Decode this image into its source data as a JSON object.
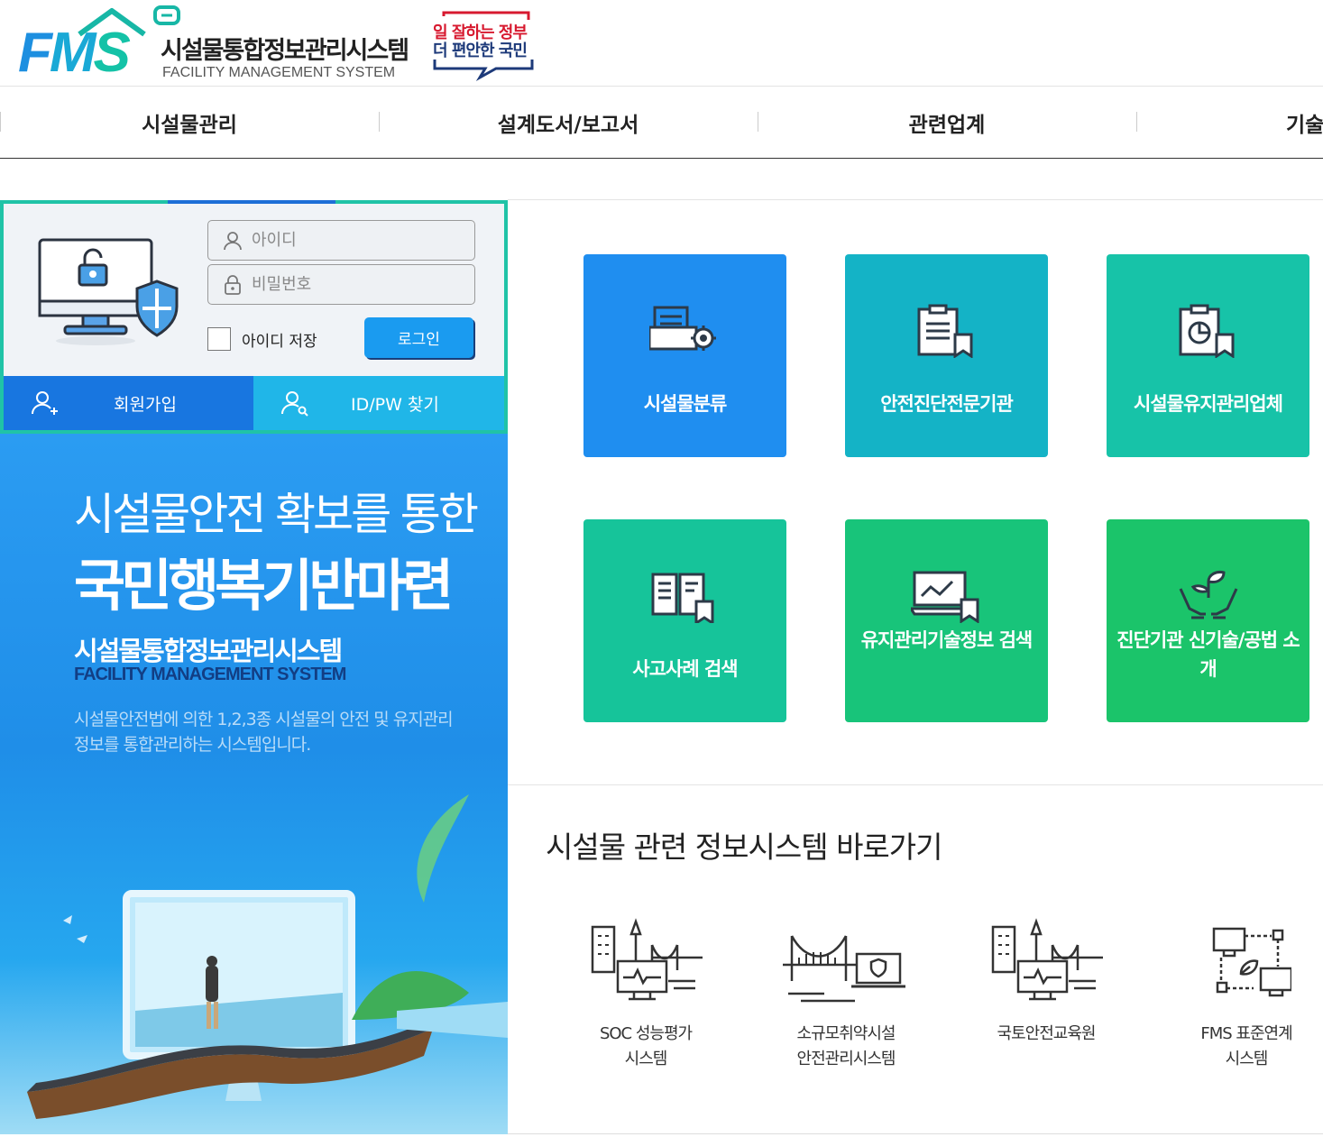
{
  "header": {
    "logo_letters": "FMS",
    "logo_kr": "시설물통합정보관리시스템",
    "logo_en": "FACILITY MANAGEMENT SYSTEM",
    "gov_line1": "일 잘하는 정부",
    "gov_line2": "더 편안한 국민"
  },
  "nav": {
    "items": [
      "시설물관리",
      "설계도서/보고서",
      "관련업계",
      "기술"
    ]
  },
  "login": {
    "id_placeholder": "아이디",
    "pw_placeholder": "비밀번호",
    "save_id_label": "아이디 저장",
    "login_button": "로그인",
    "join_label": "회원가입",
    "find_label": "ID/PW 찾기"
  },
  "promo": {
    "headline1": "시설물안전 확보를 통한",
    "headline2": "국민행복기반마련",
    "system_kr": "시설물통합정보관리시스템",
    "system_en": "FACILITY MANAGEMENT SYSTEM",
    "description": "시설물안전법에 의한 1,2,3종 시설물의 안전 및 유지관리 정보를 통합관리하는 시스템입니다."
  },
  "tiles": [
    {
      "label": "시설물분류",
      "icon": "document-gear-icon",
      "color": "#1f8ef0"
    },
    {
      "label": "안전진단전문기관",
      "icon": "clipboard-bookmark-icon",
      "color": "#14b3c6"
    },
    {
      "label": "시설물유지관리업체",
      "icon": "report-chart-icon",
      "color": "#17c3a8"
    },
    {
      "label": "사고사례 검색",
      "icon": "book-search-icon",
      "color": "#16c49a"
    },
    {
      "label": "유지관리기술정보 검색",
      "icon": "monitor-graph-icon",
      "color": "#18c47a"
    },
    {
      "label": "진단기관 신기술/공법 소개",
      "icon": "hands-plant-icon",
      "color": "#1bc46a"
    }
  ],
  "shortcuts": {
    "title": "시설물 관련 정보시스템 바로가기",
    "items": [
      {
        "line1": "SOC 성능평가",
        "line2": "시스템",
        "icon": "city-monitor-icon"
      },
      {
        "line1": "소규모취약시설",
        "line2": "안전관리시스템",
        "icon": "bridge-laptop-icon"
      },
      {
        "line1": "국토안전교육원",
        "line2": "",
        "icon": "city-monitor-icon"
      },
      {
        "line1": "FMS 표준연계",
        "line2": "시스템",
        "icon": "network-link-icon"
      }
    ]
  },
  "colors": {
    "brand_blue": "#1876e0",
    "brand_teal": "#20c3a7",
    "sky": "#20b6e8"
  }
}
